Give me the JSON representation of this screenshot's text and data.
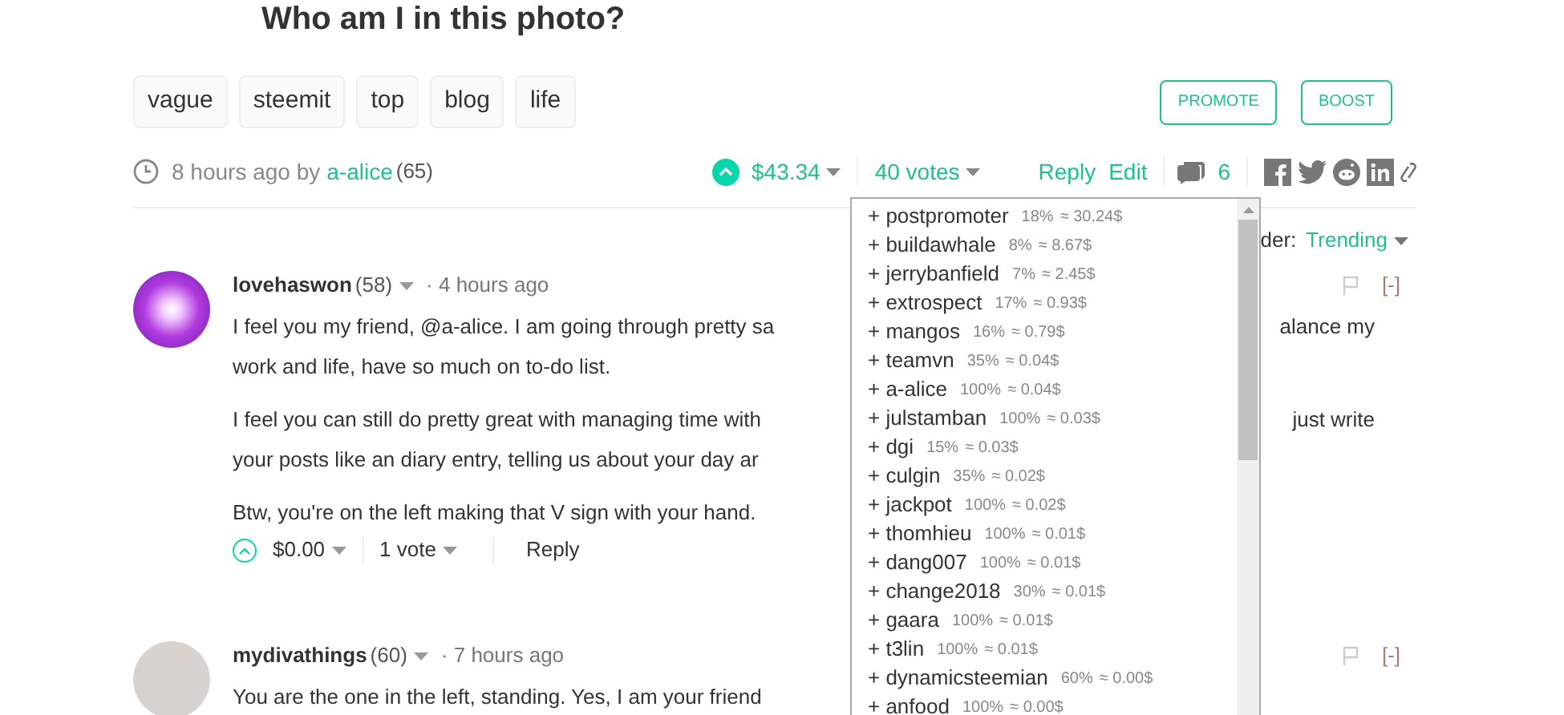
{
  "post": {
    "title": "Who am I in this photo?",
    "tags": [
      "vague",
      "steemit",
      "top",
      "blog",
      "life"
    ],
    "buttons": [
      "PROMOTE",
      "BOOST"
    ],
    "meta": {
      "time": "8 hours ago by",
      "author": "a-alice",
      "reputation": "(65)"
    },
    "payout": "$43.34",
    "votes": "40 votes",
    "actions": [
      "Reply",
      "Edit"
    ],
    "comment_count": "6"
  },
  "sort": {
    "label": "der:",
    "value": "Trending"
  },
  "voters_dropdown": [
    {
      "name": "+ postpromoter",
      "percent": "18%",
      "payout": "≈ 30.24$"
    },
    {
      "name": "+ buildawhale",
      "percent": "8%",
      "payout": "≈ 8.67$"
    },
    {
      "name": "+ jerrybanfield",
      "percent": "7%",
      "payout": "≈ 2.45$"
    },
    {
      "name": "+ extrospect",
      "percent": "17%",
      "payout": "≈ 0.93$"
    },
    {
      "name": "+ mangos",
      "percent": "16%",
      "payout": "≈ 0.79$"
    },
    {
      "name": "+ teamvn",
      "percent": "35%",
      "payout": "≈ 0.04$"
    },
    {
      "name": "+ a-alice",
      "percent": "100%",
      "payout": "≈ 0.04$"
    },
    {
      "name": "+ julstamban",
      "percent": "100%",
      "payout": "≈ 0.03$"
    },
    {
      "name": "+ dgi",
      "percent": "15%",
      "payout": "≈ 0.03$"
    },
    {
      "name": "+ culgin",
      "percent": "35%",
      "payout": "≈ 0.02$"
    },
    {
      "name": "+ jackpot",
      "percent": "100%",
      "payout": "≈ 0.02$"
    },
    {
      "name": "+ thomhieu",
      "percent": "100%",
      "payout": "≈ 0.01$"
    },
    {
      "name": "+ dang007",
      "percent": "100%",
      "payout": "≈ 0.01$"
    },
    {
      "name": "+ change2018",
      "percent": "30%",
      "payout": "≈ 0.01$"
    },
    {
      "name": "+ gaara",
      "percent": "100%",
      "payout": "≈ 0.01$"
    },
    {
      "name": "+ t3lin",
      "percent": "100%",
      "payout": "≈ 0.01$"
    },
    {
      "name": "+ dynamicsteemian",
      "percent": "60%",
      "payout": "≈ 0.00$"
    },
    {
      "name": "+ anfood",
      "percent": "100%",
      "payout": "≈ 0.00$"
    }
  ],
  "comments": [
    {
      "author": "lovehaswon",
      "reputation": "(58)",
      "time": "· 4 hours ago",
      "avatar": {
        "kind": "burst"
      },
      "collapse": "[-]",
      "paragraphs": [
        [
          {
            "left": "I feel you my friend, @a-alice. I am going through pretty sa",
            "right": "alance my"
          },
          {
            "left": "work and life, have so much on to-do list."
          }
        ],
        [
          {
            "left": "I feel you can still do pretty great with managing time with",
            "right": "just write"
          },
          {
            "left": "your posts like an diary entry, telling us about your day ar"
          }
        ],
        [
          {
            "left": "Btw, you're on the left making that V sign with your hand."
          }
        ]
      ],
      "payout": "$0.00",
      "votes": "1 vote",
      "reply": "Reply"
    },
    {
      "author": "mydivathings",
      "reputation": "(60)",
      "time": "· 7 hours ago",
      "avatar": {
        "kind": "photo"
      },
      "collapse": "[-]",
      "paragraphs": [
        [
          {
            "left": "You are the one in the left, standing. Yes, I am your friend"
          }
        ]
      ]
    }
  ]
}
